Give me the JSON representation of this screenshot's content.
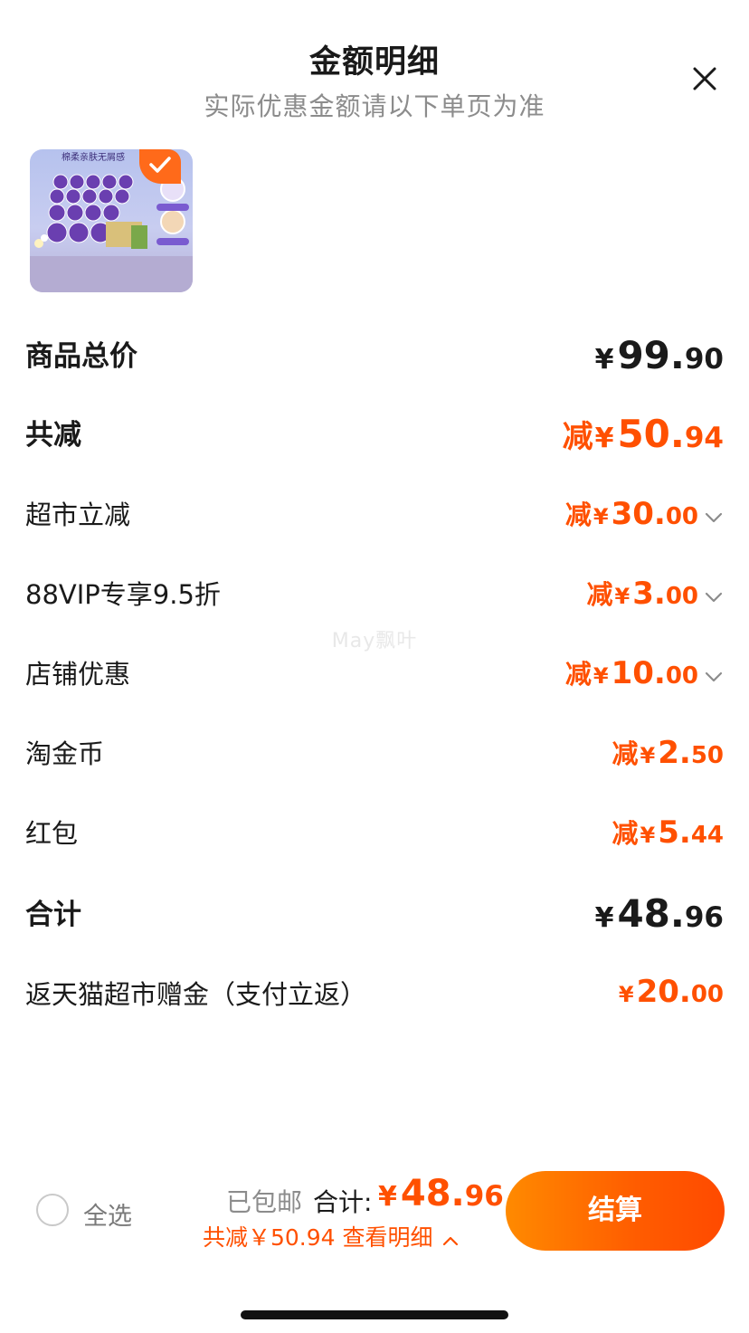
{
  "header": {
    "title": "金额明细",
    "subtitle": "实际优惠金额请以下单页为准",
    "close_icon": "close-icon"
  },
  "product": {
    "image_text": "棉柔亲肤无屑感",
    "selected": true
  },
  "summary": {
    "total_price": {
      "label": "商品总价",
      "yen": "¥",
      "int": "99.",
      "dec": "90"
    },
    "total_reduction": {
      "label": "共减",
      "prefix": "减",
      "yen": "¥",
      "int": "50.",
      "dec": "94"
    }
  },
  "discounts": [
    {
      "label": "超市立减",
      "prefix": "减",
      "yen": "¥",
      "int": "30.",
      "dec": "00",
      "expandable": true
    },
    {
      "label": "88VIP专享9.5折",
      "prefix": "减",
      "yen": "¥",
      "int": "3.",
      "dec": "00",
      "expandable": true
    },
    {
      "label": "店铺优惠",
      "prefix": "减",
      "yen": "¥",
      "int": "10.",
      "dec": "00",
      "expandable": true
    },
    {
      "label": "淘金币",
      "prefix": "减",
      "yen": "¥",
      "int": "2.",
      "dec": "50",
      "expandable": false
    },
    {
      "label": "红包",
      "prefix": "减",
      "yen": "¥",
      "int": "5.",
      "dec": "44",
      "expandable": false
    }
  ],
  "total": {
    "label": "合计",
    "yen": "¥",
    "int": "48.",
    "dec": "96"
  },
  "rebate": {
    "label": "返天猫超市赠金（支付立返）",
    "yen": "¥",
    "int": "20.",
    "dec": "00"
  },
  "watermark": "May飘叶",
  "footer": {
    "select_all": "全选",
    "shipped": "已包邮",
    "total_label": "合计:",
    "total_yen": "¥",
    "total_int": "48.",
    "total_dec": "96",
    "summary_line": "共减￥50.94  查看明细",
    "pay_button": "结算"
  },
  "colors": {
    "accent": "#ff5000",
    "button_start": "#ff8a00",
    "button_end": "#ff4a00"
  }
}
